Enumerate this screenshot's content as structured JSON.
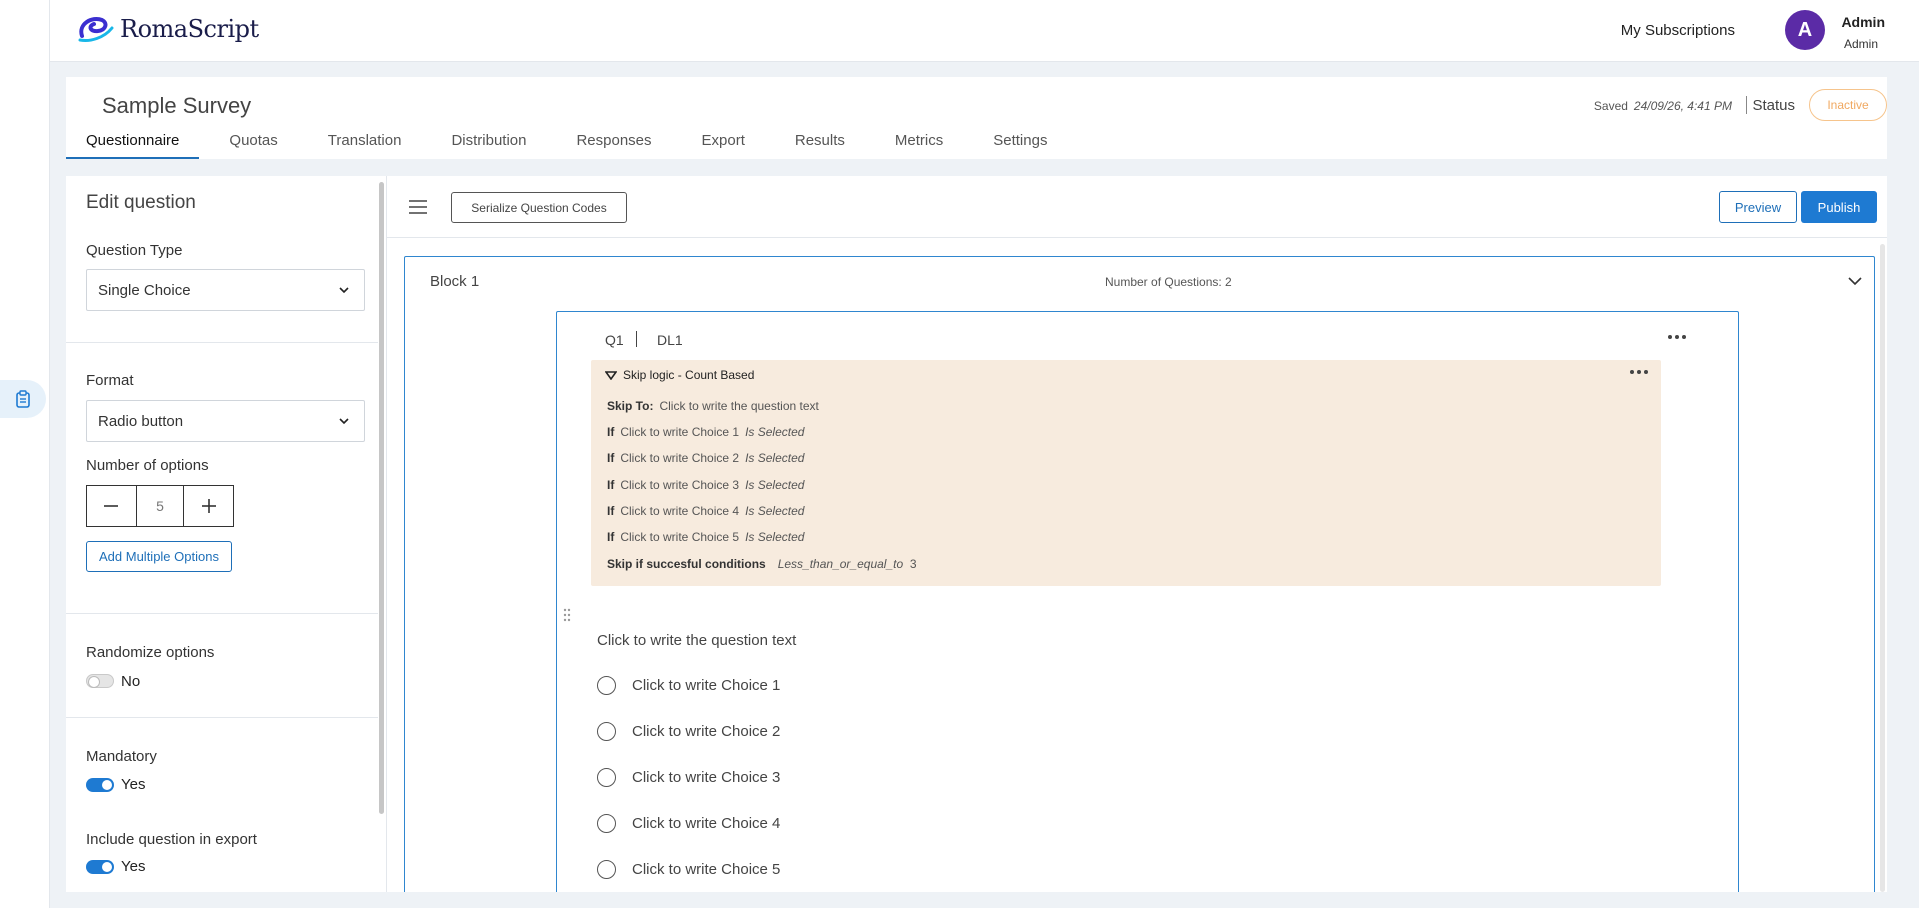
{
  "app": {
    "logo_text": "RomaScript"
  },
  "header": {
    "my_subscriptions": "My Subscriptions",
    "avatar_letter": "A",
    "user_name": "Admin",
    "user_role": "Admin"
  },
  "survey": {
    "title": "Sample Survey",
    "saved_label": "Saved",
    "saved_time": "24/09/26, 4:41 PM",
    "status_label": "Status",
    "status_value": "Inactive",
    "tabs": [
      "Questionnaire",
      "Quotas",
      "Translation",
      "Distribution",
      "Responses",
      "Export",
      "Results",
      "Metrics",
      "Settings"
    ],
    "active_tab": "Questionnaire"
  },
  "edit_panel": {
    "title": "Edit question",
    "question_type_label": "Question Type",
    "question_type_value": "Single Choice",
    "format_label": "Format",
    "format_value": "Radio button",
    "num_options_label": "Number of options",
    "num_options_value": "5",
    "add_multiple_label": "Add Multiple Options",
    "randomize_label": "Randomize options",
    "randomize_value": "No",
    "mandatory_label": "Mandatory",
    "mandatory_value": "Yes",
    "include_export_label": "Include question in export",
    "include_export_value": "Yes"
  },
  "toolbar": {
    "serialize_label": "Serialize Question Codes",
    "preview_label": "Preview",
    "publish_label": "Publish"
  },
  "block": {
    "title": "Block 1",
    "count_text": "Number of Questions: 2"
  },
  "question": {
    "code": "Q1",
    "dl": "DL1",
    "text": "Click to write the question text",
    "choices": [
      "Click to write Choice 1",
      "Click to write Choice 2",
      "Click to write Choice 3",
      "Click to write Choice 4",
      "Click to write Choice 5"
    ]
  },
  "skip_logic": {
    "title": "Skip logic - Count Based",
    "skip_to_label": "Skip To:",
    "skip_to_value": "Click to write the question text",
    "conditions": [
      {
        "if_label": "If",
        "choice": "Click to write Choice 1",
        "state": "Is Selected"
      },
      {
        "if_label": "If",
        "choice": "Click to write Choice 2",
        "state": "Is Selected"
      },
      {
        "if_label": "If",
        "choice": "Click to write Choice 3",
        "state": "Is Selected"
      },
      {
        "if_label": "If",
        "choice": "Click to write Choice 4",
        "state": "Is Selected"
      },
      {
        "if_label": "If",
        "choice": "Click to write Choice 5",
        "state": "Is Selected"
      }
    ],
    "success_label": "Skip if succesful conditions",
    "success_operator": "Less_than_or_equal_to",
    "success_value": "3"
  },
  "colors": {
    "accent": "#1e7ad2",
    "avatar": "#5b2ba6",
    "skip_bg": "#f7ebde",
    "inactive": "#f0a860"
  }
}
